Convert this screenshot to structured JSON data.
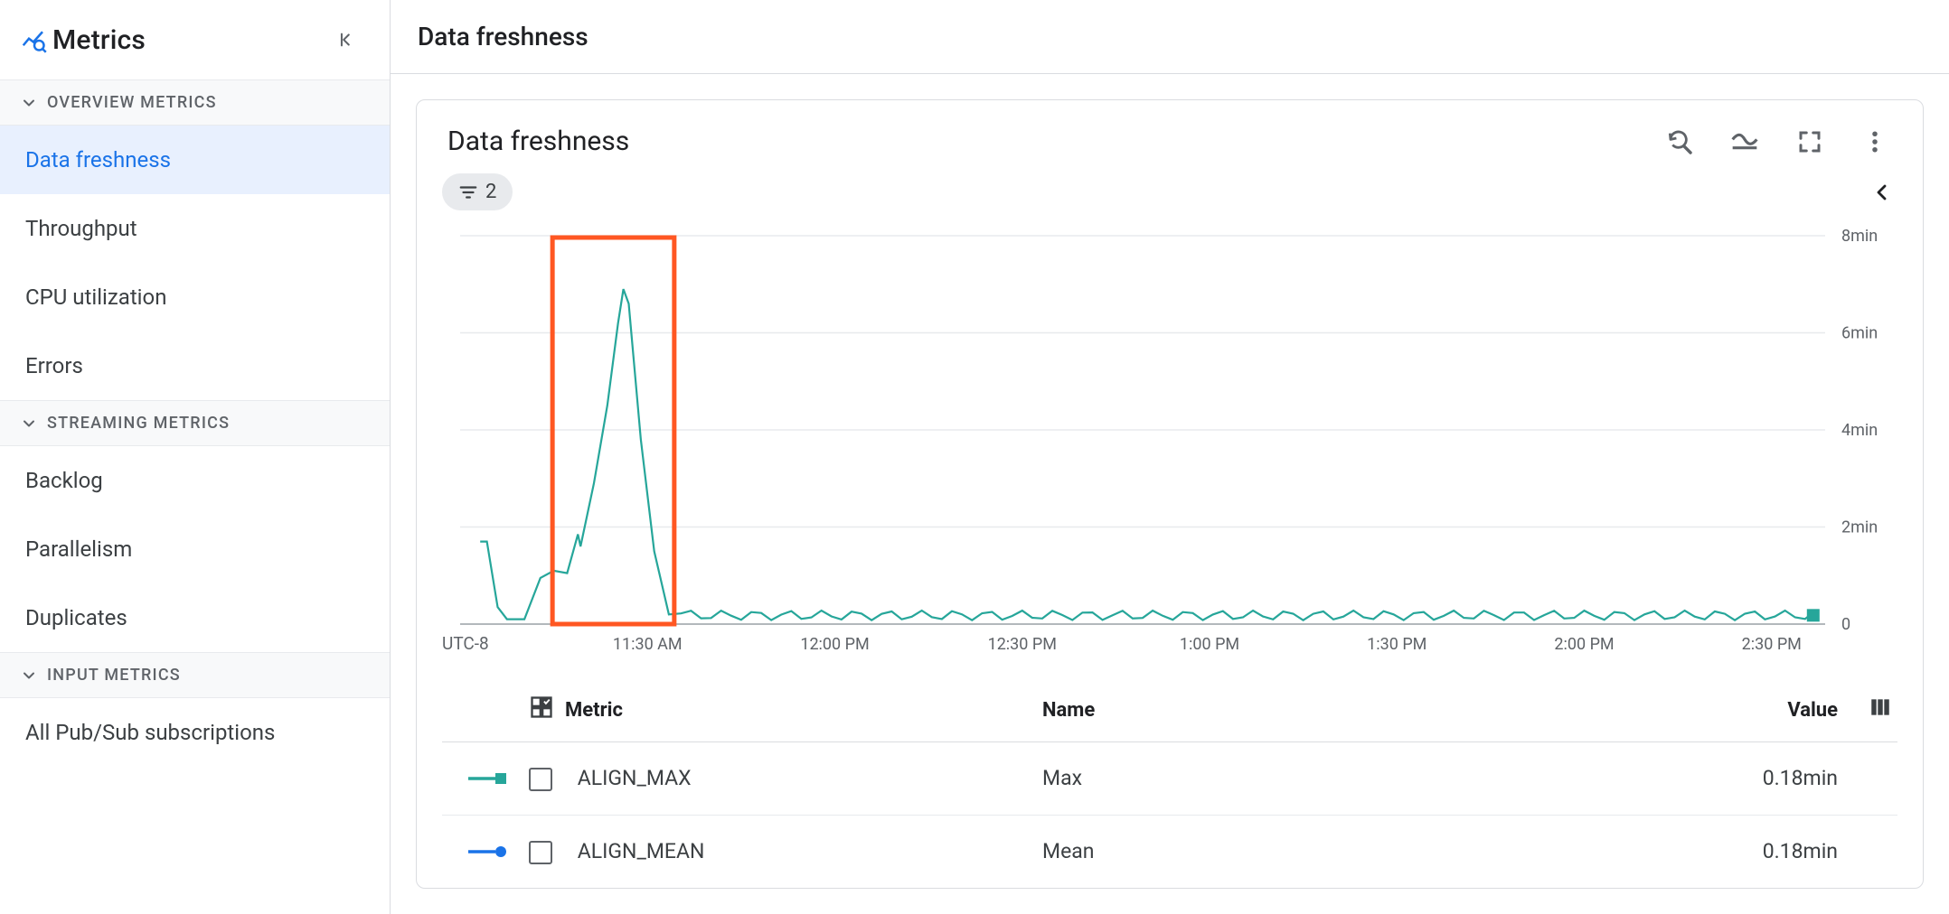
{
  "sidebar": {
    "title": "Metrics",
    "sections": [
      {
        "header": "OVERVIEW METRICS",
        "items": [
          {
            "label": "Data freshness",
            "selected": true
          },
          {
            "label": "Throughput"
          },
          {
            "label": "CPU utilization"
          },
          {
            "label": "Errors"
          }
        ]
      },
      {
        "header": "STREAMING METRICS",
        "items": [
          {
            "label": "Backlog"
          },
          {
            "label": "Parallelism"
          },
          {
            "label": "Duplicates"
          }
        ]
      },
      {
        "header": "INPUT METRICS",
        "items": [
          {
            "label": "All Pub/Sub subscriptions"
          }
        ]
      }
    ]
  },
  "page": {
    "title": "Data freshness"
  },
  "card": {
    "title": "Data freshness",
    "filter_chip_count": "2"
  },
  "chart_data": {
    "type": "line",
    "title": "Data freshness",
    "timezone": "UTC-8",
    "ylabel": "minutes",
    "ylim": [
      0,
      8
    ],
    "y_ticks": [
      {
        "v": 0,
        "label": "0"
      },
      {
        "v": 2,
        "label": "2min"
      },
      {
        "v": 4,
        "label": "4min"
      },
      {
        "v": 6,
        "label": "6min"
      },
      {
        "v": 8,
        "label": "8min"
      }
    ],
    "x_ticks": [
      {
        "t": 0.08,
        "label": "11:30 AM"
      },
      {
        "t": 0.22,
        "label": "12:00 PM"
      },
      {
        "t": 0.36,
        "label": "12:30 PM"
      },
      {
        "t": 0.5,
        "label": "1:00 PM"
      },
      {
        "t": 0.64,
        "label": "1:30 PM"
      },
      {
        "t": 0.78,
        "label": "2:00 PM"
      },
      {
        "t": 0.92,
        "label": "2:30 PM"
      }
    ],
    "highlight": {
      "x0": 0.009,
      "x1": 0.1
    },
    "series": [
      {
        "name": "ALIGN_MAX",
        "color": "#26a69a",
        "points": [
          {
            "t": -0.045,
            "v": 1.7
          },
          {
            "t": -0.04,
            "v": 1.7
          },
          {
            "t": -0.032,
            "v": 0.35
          },
          {
            "t": -0.025,
            "v": 0.1
          },
          {
            "t": -0.012,
            "v": 0.1
          },
          {
            "t": 0.0,
            "v": 0.95
          },
          {
            "t": 0.01,
            "v": 1.1
          },
          {
            "t": 0.02,
            "v": 1.05
          },
          {
            "t": 0.028,
            "v": 1.85
          },
          {
            "t": 0.03,
            "v": 1.6
          },
          {
            "t": 0.04,
            "v": 2.9
          },
          {
            "t": 0.05,
            "v": 4.5
          },
          {
            "t": 0.058,
            "v": 6.2
          },
          {
            "t": 0.062,
            "v": 6.9
          },
          {
            "t": 0.066,
            "v": 6.6
          },
          {
            "t": 0.075,
            "v": 3.8
          },
          {
            "t": 0.085,
            "v": 1.5
          },
          {
            "t": 0.096,
            "v": 0.2
          },
          {
            "t": 0.105,
            "v": 0.22
          },
          {
            "t": 0.95,
            "v": 0.18
          }
        ],
        "tail_wobble": true
      }
    ]
  },
  "legend": {
    "columns": {
      "metric": "Metric",
      "name": "Name",
      "value": "Value"
    },
    "rows": [
      {
        "swatch": "teal-square",
        "metric": "ALIGN_MAX",
        "name": "Max",
        "value": "0.18min"
      },
      {
        "swatch": "blue-dot",
        "metric": "ALIGN_MEAN",
        "name": "Mean",
        "value": "0.18min"
      }
    ]
  }
}
